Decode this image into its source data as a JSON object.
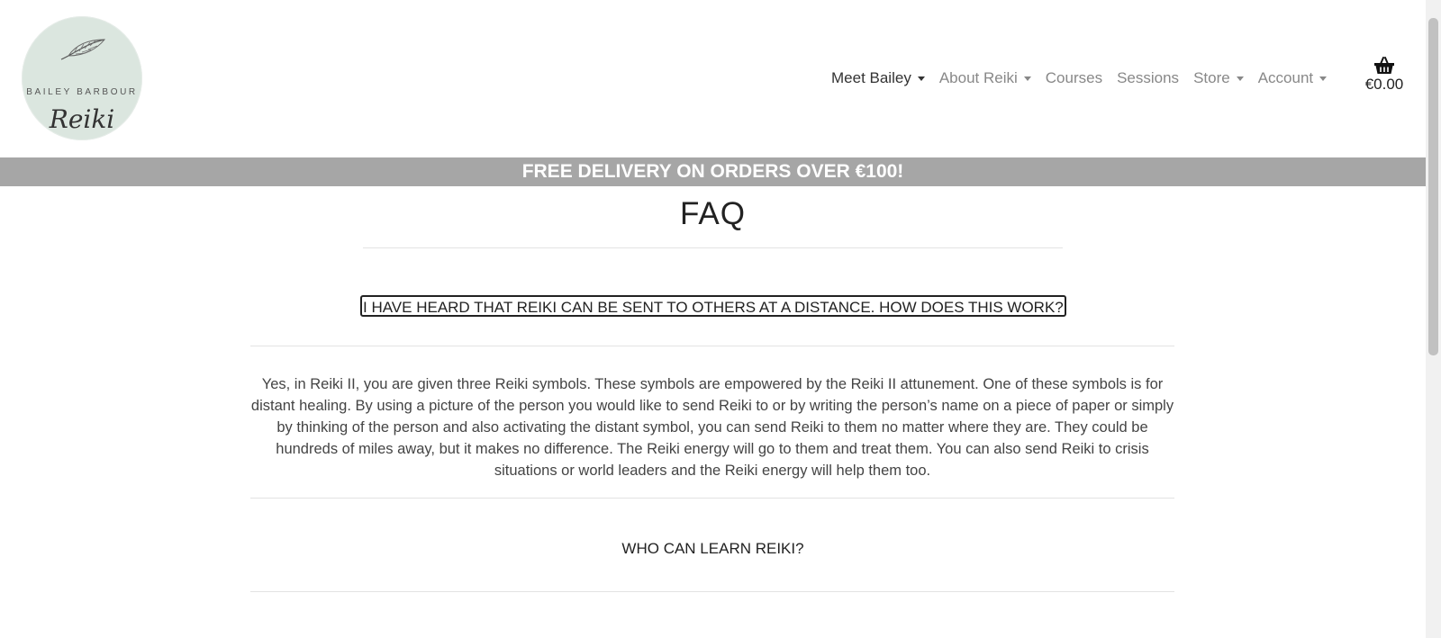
{
  "brand": {
    "top_text": "BAILEY BARBOUR",
    "bottom_text": "Reiki"
  },
  "nav": {
    "items": [
      {
        "label": "Meet Bailey"
      },
      {
        "label": "About Reiki"
      },
      {
        "label": "Courses"
      },
      {
        "label": "Sessions"
      },
      {
        "label": "Store"
      },
      {
        "label": "Account"
      }
    ]
  },
  "cart": {
    "total": "€0.00"
  },
  "banner": {
    "text": "FREE DELIVERY ON ORDERS OVER €100!"
  },
  "faq": {
    "title": "FAQ",
    "items": [
      {
        "question": "I HAVE HEARD THAT REIKI CAN BE SENT TO OTHERS AT A DISTANCE. HOW DOES THIS WORK?",
        "answer": "Yes, in Reiki II, you are given three Reiki symbols. These symbols are empowered by the Reiki II attunement. One of these symbols is for distant healing. By using a picture of the person you would like to send Reiki to or by writing the person’s name on a piece of paper or simply by thinking of the person and also activating the distant symbol, you can send Reiki to them no matter where they are. They could be hundreds of miles away, but it makes no difference. The Reiki energy will go to them and treat them. You can also send Reiki to crisis situations or world leaders and the Reiki energy will help them too."
      },
      {
        "question": "WHO CAN LEARN REIKI?"
      }
    ]
  }
}
